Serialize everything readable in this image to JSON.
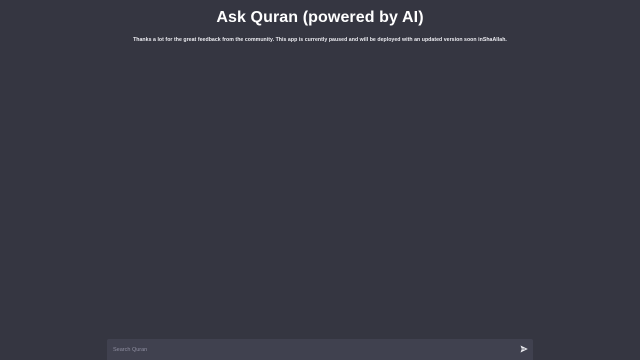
{
  "header": {
    "title": "Ask Quran (powered by AI)",
    "notice": "Thanks a lot for the great feedback from the community. This app is currently paused and will be deployed with an updated version soon inShaAllah."
  },
  "composer": {
    "placeholder": "Search Quran",
    "value": "",
    "send_icon": "send-icon"
  },
  "colors": {
    "background": "#353641",
    "composer_background": "#40414f",
    "title_text": "#ffffff",
    "placeholder_text": "#8e8ea0"
  }
}
